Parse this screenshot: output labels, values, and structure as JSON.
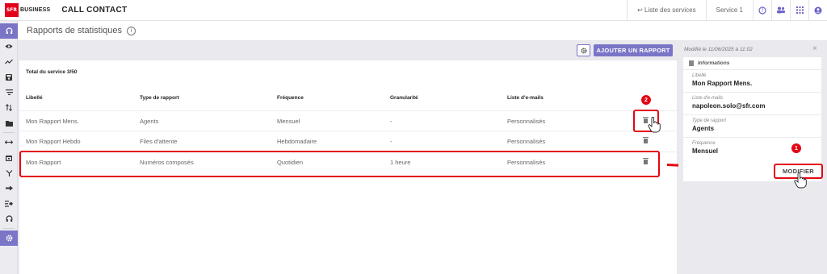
{
  "header": {
    "logo_mark": "SFR",
    "logo_text": "BUSINESS",
    "app_title": "CALL CONTACT",
    "services_link": "↩ Liste des services",
    "service_selector": "Service 1",
    "icons": [
      "help-icon",
      "users-icon",
      "apps-grid-icon",
      "user-account-icon"
    ]
  },
  "sidebar": {
    "items": [
      "headset-icon",
      "eye-icon",
      "trend-icon",
      "save-icon",
      "filter-lines-icon",
      "sort-icon",
      "folder-icon",
      "arrows-icon",
      "calendar-icon",
      "fork-icon",
      "forward-icon",
      "queue-forward-icon",
      "headphones-icon",
      "gear-icon"
    ],
    "active_index": 0,
    "settings_active": true
  },
  "page": {
    "title": "Rapports de statistiques",
    "info_glyph": "i"
  },
  "toolbar": {
    "add_report_label": "AJOUTER UN RAPPORT"
  },
  "table": {
    "total_label": "Total du service 3/50",
    "columns": [
      "Libellé",
      "Type de rapport",
      "Fréquence",
      "Granularité",
      "Liste d'e-mails"
    ],
    "rows": [
      {
        "libelle": "Mon Rapport Mens.",
        "type": "Agents",
        "frequence": "Mensuel",
        "granularite": "-",
        "emails": "Personnalisés"
      },
      {
        "libelle": "Mon Rapport Hebdo",
        "type": "Files d'attente",
        "frequence": "Hebdomadaire",
        "granularite": "-",
        "emails": "Personnalisés"
      },
      {
        "libelle": "Mon Rapport",
        "type": "Numéros composés",
        "frequence": "Quotidien",
        "granularite": "1 heure",
        "emails": "Personnalisés"
      }
    ]
  },
  "annotations": {
    "badge_1": "1",
    "badge_2": "2",
    "highlight_color": "#e30613"
  },
  "details_panel": {
    "modified_text": "Modifié le 11/06/2025 à 11:02",
    "close_glyph": "×",
    "section_title": "Informations",
    "fields": [
      {
        "label": "Libellé",
        "value": "Mon Rapport Mens."
      },
      {
        "label": "Liste d'e-mails",
        "value": "napoleon.solo@sfr.com"
      },
      {
        "label": "Type de rapport",
        "value": "Agents"
      },
      {
        "label": "Fréquence",
        "value": "Mensuel"
      }
    ],
    "modify_label": "MODIFIER"
  },
  "colors": {
    "accent": "#7a75c7",
    "brand_red": "#e2001a"
  }
}
